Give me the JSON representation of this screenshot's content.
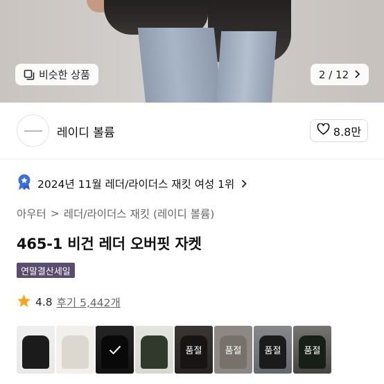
{
  "hero": {
    "similar_label": "비슷한 상품",
    "pager": {
      "current": "2",
      "separator": "/",
      "total": "12"
    }
  },
  "brand": {
    "name": "레이디 볼륨",
    "like_count": "8.8만"
  },
  "ranking": {
    "text": "2024년 11월 레더/라이더스 재킷 여성 1위"
  },
  "breadcrumb": {
    "category": "아우터",
    "separator": ">",
    "subcategory": "레더/라이더스 재킷 (레이디 볼륨)"
  },
  "product": {
    "title": "465-1 비건 레더 오버핏 자켓",
    "badge": "연말결산세일",
    "rating": "4.8",
    "reviews": "후기 5,442개"
  },
  "colors": {
    "star": "#f7a51d",
    "badge_bg": "#5a4c6f",
    "rank_badge": "#3b6fd8"
  },
  "thumbnails": [
    {
      "label": "",
      "soldout": false,
      "selected": false
    },
    {
      "label": "",
      "soldout": false,
      "selected": false
    },
    {
      "label": "",
      "soldout": false,
      "selected": true
    },
    {
      "label": "",
      "soldout": false,
      "selected": false
    },
    {
      "label": "품절",
      "soldout": true,
      "selected": false
    },
    {
      "label": "품절",
      "soldout": true,
      "selected": false
    },
    {
      "label": "품절",
      "soldout": true,
      "selected": false
    },
    {
      "label": "품절",
      "soldout": true,
      "selected": false
    }
  ]
}
